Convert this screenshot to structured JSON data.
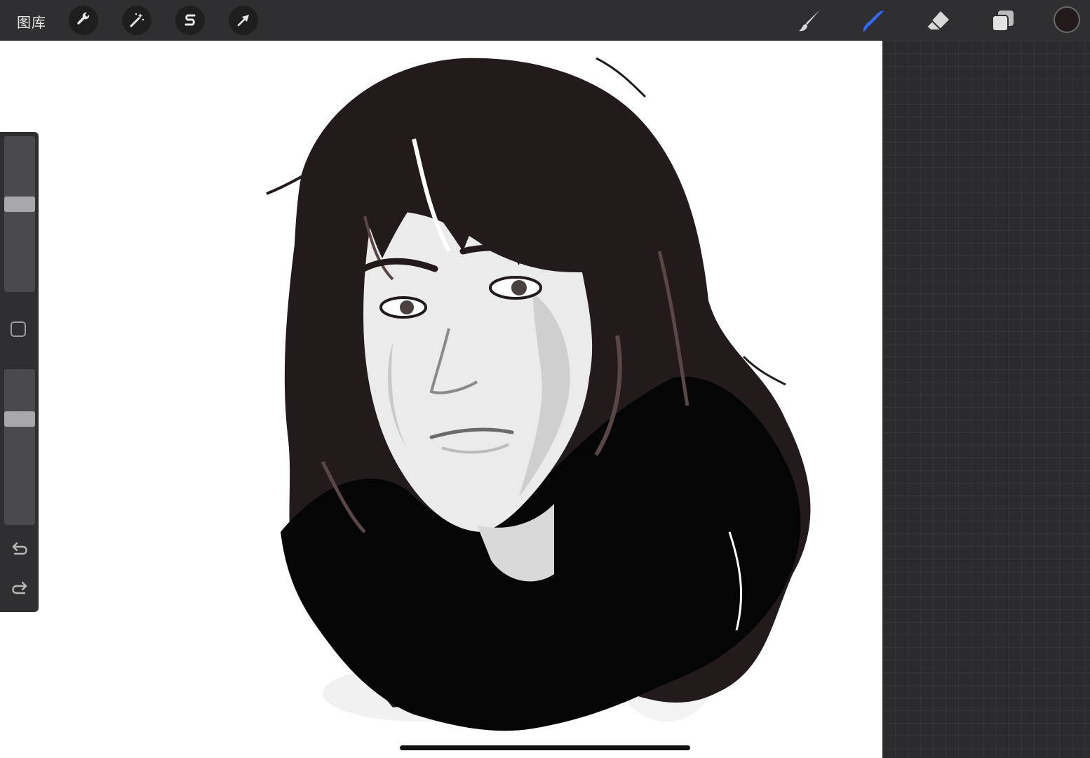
{
  "toolbar": {
    "gallery_label": "图库",
    "left_tools": [
      {
        "name": "actions",
        "icon": "wrench-icon"
      },
      {
        "name": "adjustments",
        "icon": "magic-wand-icon"
      },
      {
        "name": "selection",
        "icon": "selection-s-icon"
      },
      {
        "name": "transform",
        "icon": "arrow-cursor-icon"
      }
    ],
    "right_tools": [
      {
        "name": "brush",
        "icon": "brush-icon",
        "active": false
      },
      {
        "name": "smudge",
        "icon": "smudge-finger-icon",
        "active": true
      },
      {
        "name": "eraser",
        "icon": "eraser-icon",
        "active": false
      },
      {
        "name": "layers",
        "icon": "layers-icon",
        "active": false
      }
    ],
    "current_color": "#231b1b",
    "active_color": "#2f6bff"
  },
  "sidebar": {
    "brush_size": 0.57,
    "opacity": 0.7
  }
}
